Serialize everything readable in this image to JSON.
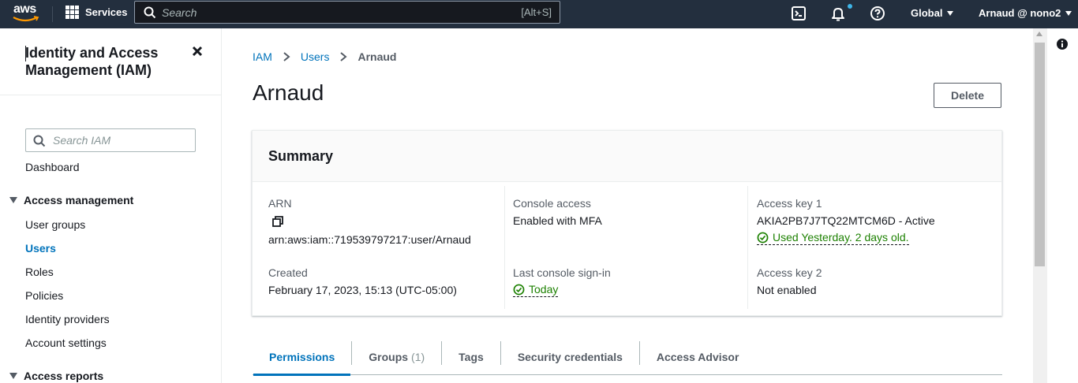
{
  "topnav": {
    "logo_text": "aws",
    "services_label": "Services",
    "search_placeholder": "Search",
    "search_shortcut": "[Alt+S]",
    "region_label": "Global",
    "account_label": "Arnaud @ nono2",
    "icons": [
      "cloudshell-icon",
      "bell-icon",
      "help-icon"
    ]
  },
  "sidebar": {
    "title": "Identity and Access Management (IAM)",
    "search_placeholder": "Search IAM",
    "dashboard": "Dashboard",
    "access_management": {
      "label": "Access management",
      "items": [
        "User groups",
        "Users",
        "Roles",
        "Policies",
        "Identity providers",
        "Account settings"
      ],
      "active": "Users"
    },
    "access_reports": {
      "label": "Access reports"
    }
  },
  "breadcrumb": [
    "IAM",
    "Users",
    "Arnaud"
  ],
  "page": {
    "title": "Arnaud",
    "delete_label": "Delete"
  },
  "summary": {
    "title": "Summary",
    "arn_label": "ARN",
    "arn_value": "arn:aws:iam::719539797217:user/Arnaud",
    "created_label": "Created",
    "created_value": "February 17, 2023, 15:13 (UTC-05:00)",
    "console_access_label": "Console access",
    "console_access_value": "Enabled with MFA",
    "last_signin_label": "Last console sign-in",
    "last_signin_value": "Today",
    "access_key1_label": "Access key 1",
    "access_key1_value": "AKIA2PB7J7TQ22MTCM6D - Active",
    "access_key1_status": "Used Yesterday. 2 days old.",
    "access_key2_label": "Access key 2",
    "access_key2_value": "Not enabled"
  },
  "tabs": [
    {
      "label": "Permissions",
      "count": ""
    },
    {
      "label": "Groups",
      "count": "(1)"
    },
    {
      "label": "Tags",
      "count": ""
    },
    {
      "label": "Security credentials",
      "count": ""
    },
    {
      "label": "Access Advisor",
      "count": ""
    }
  ],
  "colors": {
    "nav_bg": "#232f3e",
    "link": "#0073bb",
    "success": "#1d8102",
    "text": "#16191f"
  }
}
